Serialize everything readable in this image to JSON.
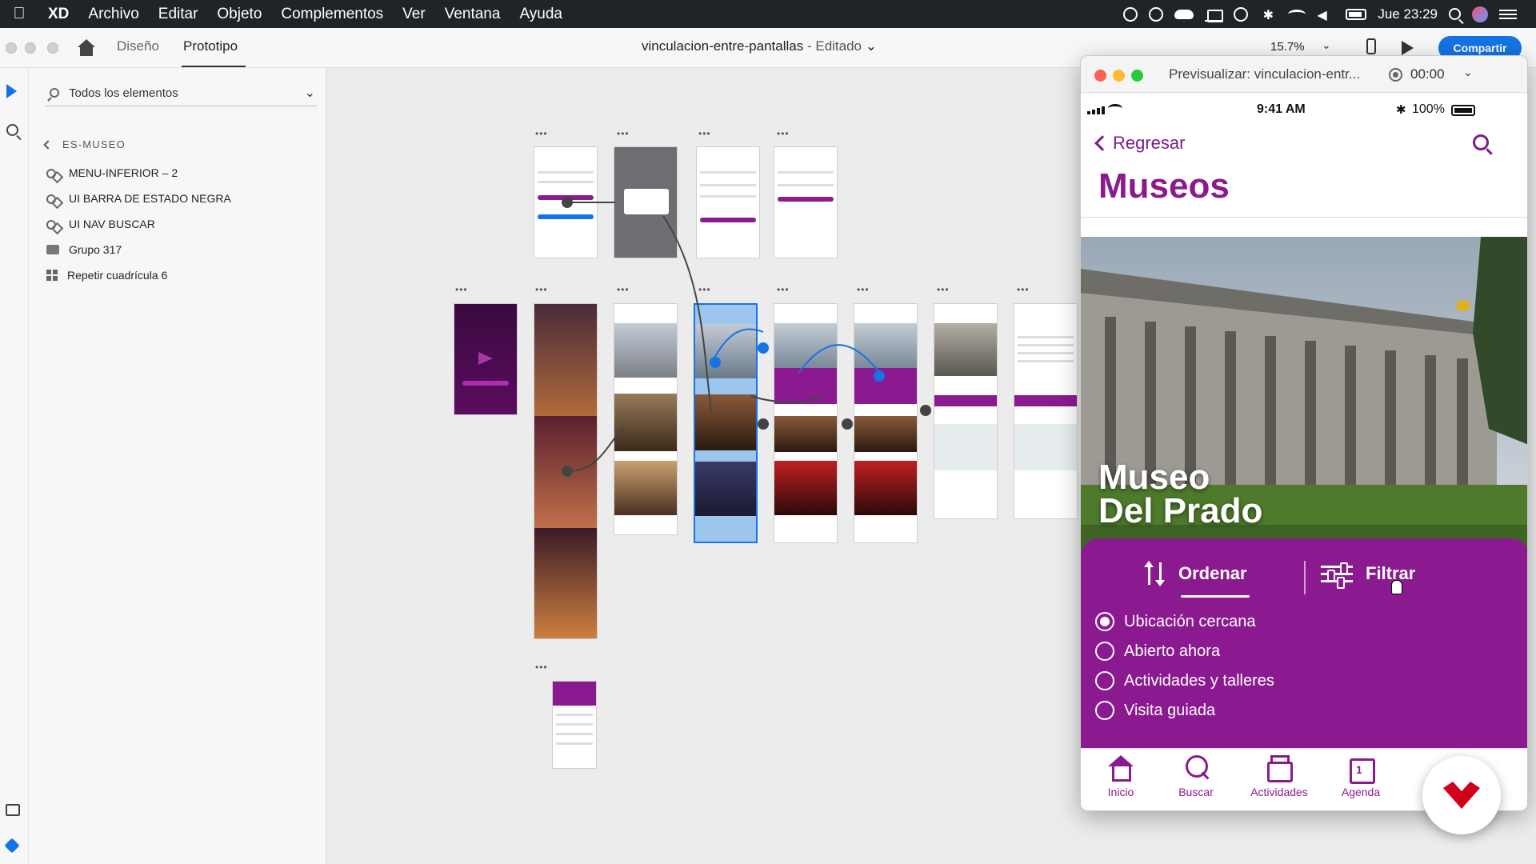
{
  "menubar": {
    "app": "XD",
    "items": [
      "Archivo",
      "Editar",
      "Objeto",
      "Complementos",
      "Ver",
      "Ventana",
      "Ayuda"
    ],
    "clock": "Jue 23:29"
  },
  "toolbar": {
    "tab_design": "Diseño",
    "tab_prototype": "Prototipo",
    "document": "vinculacion-entre-pantallas",
    "document_status": "- Editado",
    "zoom": "15.7%",
    "share": "Compartir"
  },
  "layers": {
    "search_placeholder": "Todos los elementos",
    "group": "ES-MUSEO",
    "items": [
      {
        "label": "MENU-INFERIOR – 2",
        "icon": "component-icon"
      },
      {
        "label": "UI BARRA DE ESTADO NEGRA",
        "icon": "component-icon"
      },
      {
        "label": "UI NAV BUSCAR",
        "icon": "component-icon"
      },
      {
        "label": "Grupo 317",
        "icon": "folder-icon"
      },
      {
        "label": "Repetir cuadrícula 6",
        "icon": "repeat-grid-icon"
      }
    ]
  },
  "preview": {
    "title": "Previsualizar: vinculacion-entr...",
    "time": "00:00",
    "status_time": "9:41 AM",
    "battery": "100%",
    "back": "Regresar",
    "page_title": "Museos",
    "hero_title_line1": "Museo",
    "hero_title_line2": "Del Prado",
    "sort": "Ordenar",
    "filter": "Filtrar",
    "options": [
      "Ubicación cercana",
      "Abierto ahora",
      "Actividades y talleres",
      "Visita guiada"
    ],
    "selected_option": "Ubicación cercana",
    "tabs": [
      "Inicio",
      "Buscar",
      "Actividades",
      "Agenda"
    ]
  },
  "colors": {
    "brand_purple": "#8b1a91",
    "accent_blue": "#1473e6",
    "brand_red": "#d0021b"
  }
}
